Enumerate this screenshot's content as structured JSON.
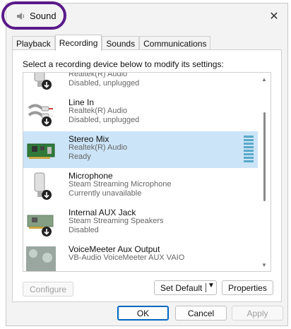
{
  "window": {
    "title": "Sound",
    "close_icon": "close-icon",
    "accent_color": "#5b1a8a"
  },
  "tabs": [
    {
      "label": "Playback",
      "active": false
    },
    {
      "label": "Recording",
      "active": true
    },
    {
      "label": "Sounds",
      "active": false
    },
    {
      "label": "Communications",
      "active": false
    }
  ],
  "instruction": "Select a recording device below to modify its settings:",
  "devices": [
    {
      "icon": "microphone-icon",
      "name": "",
      "description": "Realtek(R) Audio",
      "status": "Disabled, unplugged",
      "selected": false
    },
    {
      "icon": "line-in-cable-icon",
      "name": "Line In",
      "description": "Realtek(R) Audio",
      "status": "Disabled, unplugged",
      "selected": false
    },
    {
      "icon": "sound-card-icon",
      "name": "Stereo Mix",
      "description": "Realtek(R) Audio",
      "status": "Ready",
      "selected": true
    },
    {
      "icon": "microphone-icon",
      "name": "Microphone",
      "description": "Steam Streaming Microphone",
      "status": "Currently unavailable",
      "selected": false
    },
    {
      "icon": "sound-card-icon",
      "name": "Internal AUX Jack",
      "description": "Steam Streaming Speakers",
      "status": "Disabled",
      "selected": false
    },
    {
      "icon": "voicemeeter-icon",
      "name": "VoiceMeeter Aux Output",
      "description": "VB-Audio VoiceMeeter AUX VAIO",
      "status": "",
      "selected": false
    }
  ],
  "buttons": {
    "configure": "Configure",
    "set_default": "Set Default",
    "properties": "Properties",
    "ok": "OK",
    "cancel": "Cancel",
    "apply": "Apply"
  },
  "colors": {
    "selection": "#cce4f7",
    "level_meter": "#5aa9c9",
    "primary_border": "#0067c0"
  }
}
